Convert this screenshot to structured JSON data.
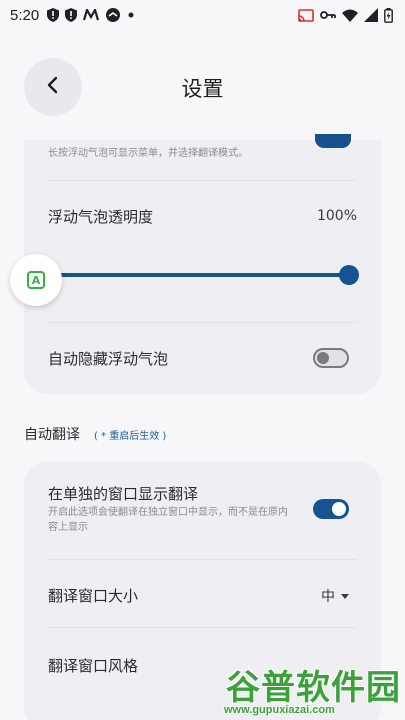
{
  "status_bar": {
    "time": "5:20",
    "left_icons": [
      "shield-alert-icon",
      "shield-alert-icon",
      "m-logo-icon",
      "dashboard-icon",
      "dot-icon"
    ],
    "right_icons": [
      "cast-icon",
      "vpn-key-icon",
      "wifi-icon",
      "signal-icon",
      "battery-icon"
    ]
  },
  "header": {
    "title": "设置",
    "back_icon": "chevron-left-icon"
  },
  "floating_bubble": {
    "text": "A",
    "color": "#34b24a"
  },
  "card1": {
    "top_desc": "长按浮动气泡可显示菜单，并选择翻译模式。",
    "opacity_label": "浮动气泡透明度",
    "opacity_value": "100%",
    "opacity_level": 1.0,
    "autohide_label": "自动隐藏浮动气泡",
    "autohide_on": false
  },
  "section": {
    "title": "自动翻译",
    "note": "( * 重启后生效 )"
  },
  "card2": {
    "separate_window_label": "在单独的窗口显示翻译",
    "separate_window_desc": "开启此选项会使翻译在独立窗口中显示，而不是在原内容上显示",
    "separate_window_on": true,
    "window_size_label": "翻译窗口大小",
    "window_size_value": "中",
    "window_style_label": "翻译窗口风格"
  },
  "watermark": {
    "text": "谷普软件园",
    "url": "www.gupuxiazai.com"
  },
  "colors": {
    "accent": "#14548f",
    "background": "#f7f7f9",
    "card": "#efeff3"
  }
}
